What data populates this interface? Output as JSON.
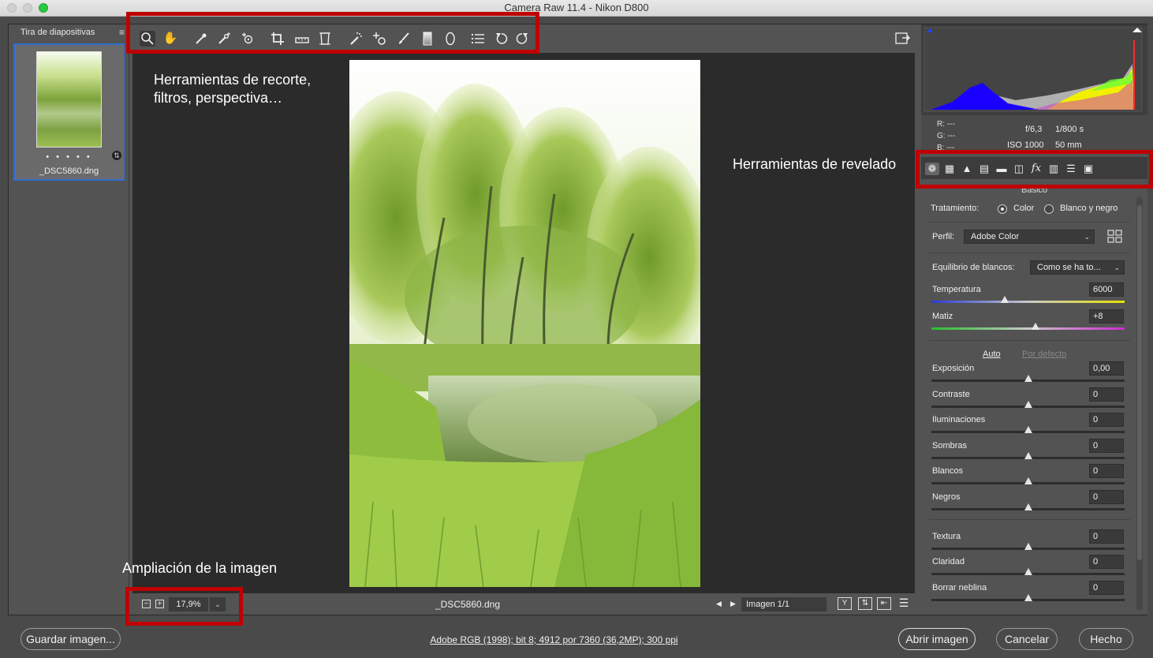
{
  "window": {
    "title": "Camera Raw 11.4 -  Nikon D800"
  },
  "filmstrip": {
    "header": "Tira de diapositivas",
    "dots": "• • • • •",
    "filename": "_DSC5860.dng"
  },
  "toolbar": {
    "tools": [
      "zoom-icon",
      "hand-icon",
      "white-balance-icon",
      "color-sampler-icon",
      "targeted-adjustment-icon",
      "crop-icon",
      "straighten-icon",
      "transform-icon",
      "spot-removal-icon",
      "red-eye-icon",
      "adjustment-brush-icon",
      "graduated-filter-icon",
      "radial-filter-icon",
      "presets-list-icon",
      "rotate-left-icon",
      "rotate-right-icon"
    ]
  },
  "annotations": {
    "tools": "Herramientas de recorte, filtros, perspectiva…",
    "develop": "Herramientas de revelado",
    "zoom": "Ampliación de la imagen"
  },
  "statusbar": {
    "zoom_value": "17,9%",
    "filename": "_DSC5860.dng",
    "image_count": "Imagen 1/1"
  },
  "info": {
    "r_label": "R:",
    "r_value": "---",
    "g_label": "G:",
    "g_value": "---",
    "b_label": "B:",
    "b_value": "---",
    "aperture": "f/6,3",
    "shutter": "1/800 s",
    "iso": "ISO 1000",
    "focal": "50 mm"
  },
  "panel": {
    "section": "Básico",
    "tratamiento_label": "Tratamiento:",
    "color_label": "Color",
    "bw_label": "Blanco y negro",
    "perfil_label": "Perfil:",
    "perfil_value": "Adobe Color",
    "wb_label": "Equilibrio de blancos:",
    "wb_value": "Como se ha to...",
    "auto_label": "Auto",
    "default_label": "Por defecto",
    "sliders": [
      {
        "label": "Temperatura",
        "value": "6000",
        "level": 0.38
      },
      {
        "label": "Matiz",
        "value": "+8",
        "level": 0.54
      },
      {
        "label": "Exposición",
        "value": "0,00",
        "level": 0.5
      },
      {
        "label": "Contraste",
        "value": "0",
        "level": 0.5
      },
      {
        "label": "Iluminaciones",
        "value": "0",
        "level": 0.5
      },
      {
        "label": "Sombras",
        "value": "0",
        "level": 0.5
      },
      {
        "label": "Blancos",
        "value": "0",
        "level": 0.5
      },
      {
        "label": "Negros",
        "value": "0",
        "level": 0.5
      },
      {
        "label": "Textura",
        "value": "0",
        "level": 0.5
      },
      {
        "label": "Claridad",
        "value": "0",
        "level": 0.5
      },
      {
        "label": "Borrar neblina",
        "value": "0",
        "level": 0.5
      }
    ]
  },
  "bottom": {
    "save": "Guardar imagen...",
    "info_link": "Adobe RGB (1998); bit 8; 4912 por 7360 (36,2MP); 300 ppi",
    "open": "Abrir imagen",
    "cancel": "Cancelar",
    "done": "Hecho"
  },
  "colors": {
    "annotation": "#c00000",
    "accent": "#2f6fd1"
  }
}
